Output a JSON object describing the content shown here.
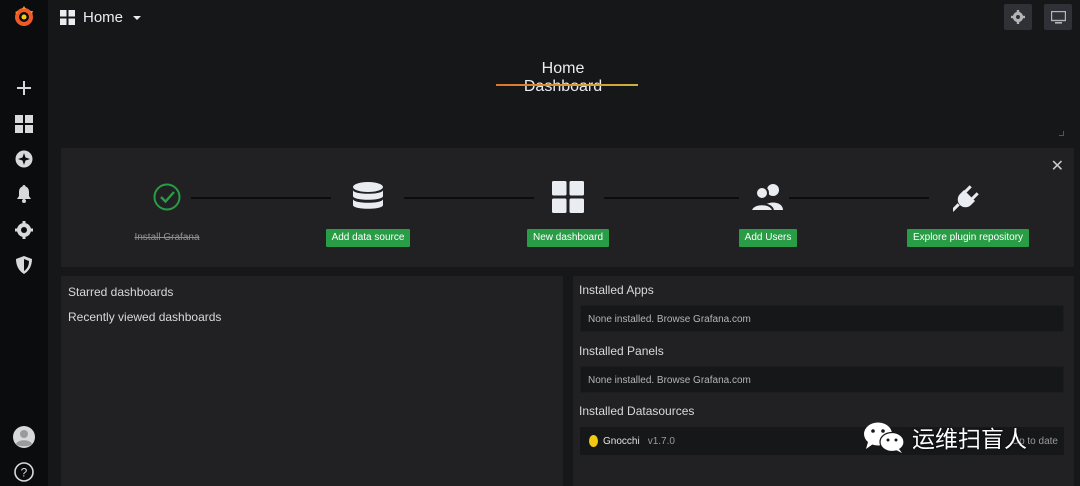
{
  "topbar": {
    "dashboard_label": "Home",
    "settings_icon": "gear-icon",
    "tv_icon": "monitor-icon"
  },
  "sidebar": {
    "items": [
      {
        "icon": "grafana-logo-icon"
      },
      {
        "icon": "plus-icon"
      },
      {
        "icon": "dashboards-icon"
      },
      {
        "icon": "explore-compass-icon"
      },
      {
        "icon": "bell-icon"
      },
      {
        "icon": "gear-icon"
      },
      {
        "icon": "shield-icon"
      },
      {
        "icon": "user-avatar-icon"
      },
      {
        "icon": "help-icon"
      }
    ]
  },
  "title_panel": {
    "title": "Home Dashboard"
  },
  "getting_started": {
    "steps": [
      {
        "label": "Install Grafana",
        "done": true,
        "icon": "check-circle-icon"
      },
      {
        "label": "Add data source",
        "done": false,
        "icon": "database-icon"
      },
      {
        "label": "New dashboard",
        "done": false,
        "icon": "dashboard-grid-icon"
      },
      {
        "label": "Add Users",
        "done": false,
        "icon": "users-icon"
      },
      {
        "label": "Explore plugin repository",
        "done": false,
        "icon": "plug-icon"
      }
    ]
  },
  "left_panel": {
    "starred": "Starred dashboards",
    "recent": "Recently viewed dashboards"
  },
  "right_panel": {
    "apps_heading": "Installed Apps",
    "apps_text": "None installed. Browse Grafana.com",
    "panels_heading": "Installed Panels",
    "panels_text": "None installed. Browse Grafana.com",
    "datasources_heading": "Installed Datasources",
    "datasource": {
      "name": "Gnocchi",
      "version": "v1.7.0",
      "status": "Up to date"
    }
  },
  "watermark": {
    "text": "运维扫盲人"
  },
  "colors": {
    "background": "#161719",
    "panel": "#212124",
    "sidebar": "#0b0c0e",
    "success_button": "#299c46",
    "accent_orange": "#e0752d"
  }
}
